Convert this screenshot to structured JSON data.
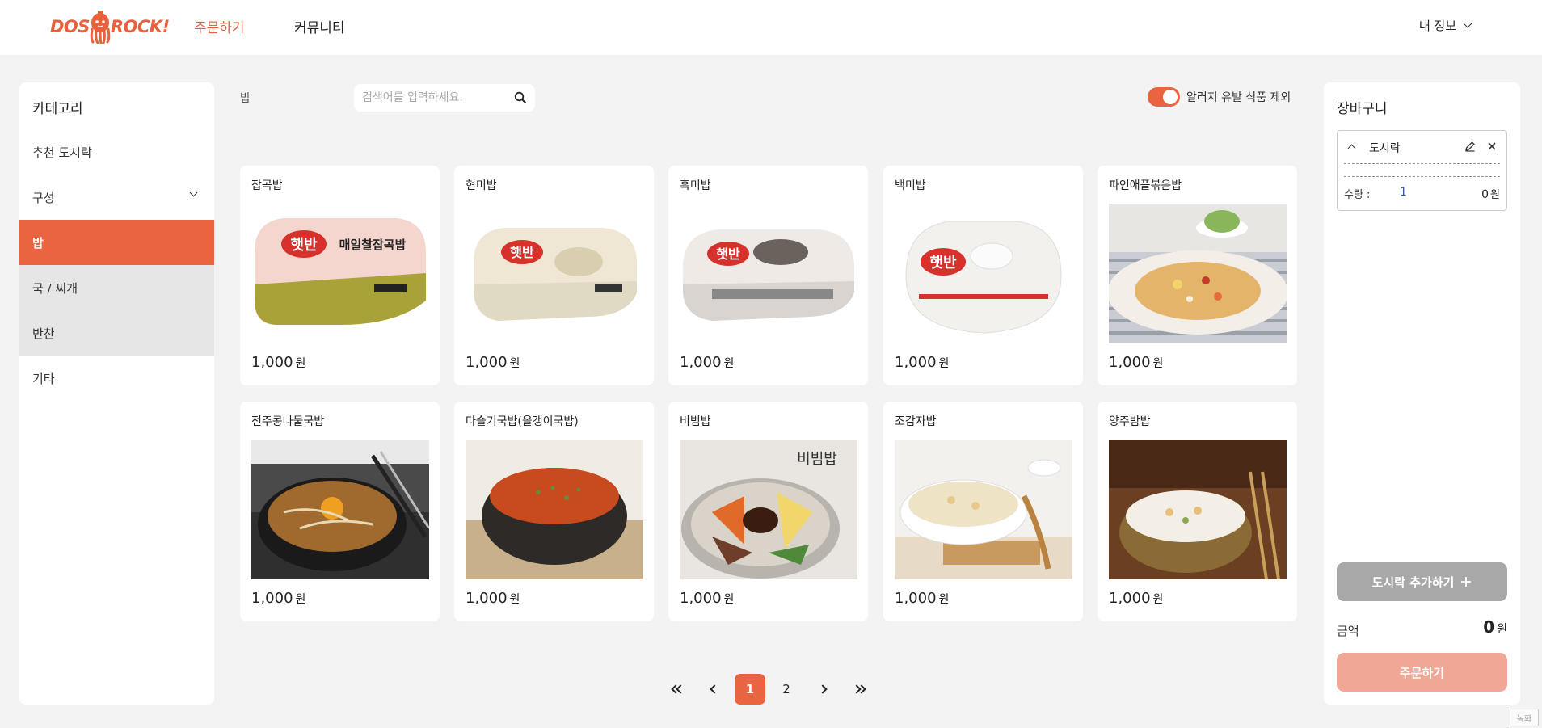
{
  "header": {
    "logo_left": "DOS",
    "logo_right": "ROCK!",
    "nav": [
      {
        "label": "주문하기"
      },
      {
        "label": "커뮤니티"
      }
    ],
    "user_menu": "내 정보"
  },
  "sidebar": {
    "title": "카테고리",
    "items": [
      {
        "label": "추천 도시락"
      },
      {
        "label": "구성"
      },
      {
        "label": "밥"
      },
      {
        "label": "국 / 찌개"
      },
      {
        "label": "반찬"
      },
      {
        "label": "기타"
      }
    ]
  },
  "main": {
    "breadcrumb": "밥",
    "search_placeholder": "검색어를 입력하세요.",
    "allergy_toggle_label": "알러지 유발 식품 제외",
    "allergy_toggle_on": true,
    "currency": "원",
    "products": [
      {
        "name": "잡곡밥",
        "price": "1,000",
        "image": "rice-tray-multigrain"
      },
      {
        "name": "현미밥",
        "price": "1,000",
        "image": "rice-tray-brown"
      },
      {
        "name": "흑미밥",
        "price": "1,000",
        "image": "rice-tray-black"
      },
      {
        "name": "백미밥",
        "price": "1,000",
        "image": "rice-tray-white"
      },
      {
        "name": "파인애플볶음밥",
        "price": "1,000",
        "image": "pineapple-fried-rice-photo"
      },
      {
        "name": "전주콩나물국밥",
        "price": "1,000",
        "image": "bean-sprout-soup-photo"
      },
      {
        "name": "다슬기국밥(올갱이국밥)",
        "price": "1,000",
        "image": "snail-soup-photo"
      },
      {
        "name": "비빔밥",
        "price": "1,000",
        "image": "bibimbap-photo"
      },
      {
        "name": "조감자밥",
        "price": "1,000",
        "image": "potato-rice-photo"
      },
      {
        "name": "양주밤밥",
        "price": "1,000",
        "image": "chestnut-rice-photo"
      }
    ],
    "image_labels": {
      "brand": "햇반",
      "multigrain_tray_text": "매일찰잡곡밥",
      "bibimbap_text": "비빔밥"
    },
    "pagination": {
      "pages": [
        "1",
        "2"
      ],
      "current": "1"
    }
  },
  "cart": {
    "title": "장바구니",
    "item": {
      "name": "도시락",
      "qty_label": "수량 :",
      "qty": "1",
      "price": "0"
    },
    "add_button": "도시락 추가하기",
    "total_label": "금액",
    "total_value": "0",
    "order_button": "주문하기"
  },
  "colors": {
    "accent": "#ea6441",
    "order_button_disabled": "#f0a796",
    "add_button": "#a8a8a8",
    "background": "#f3f3f3"
  },
  "watermark": "녹화"
}
